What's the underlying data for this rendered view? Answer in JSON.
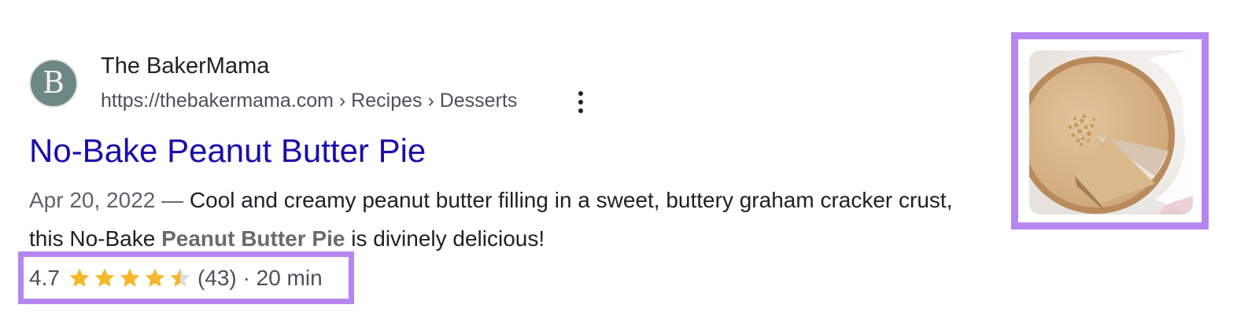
{
  "result": {
    "site_name": "The BakerMama",
    "favicon_letter": "B",
    "url": "https://thebakermama.com › Recipes › Desserts",
    "title": "No-Bake Peanut Butter Pie",
    "snippet": {
      "date": "Apr 20, 2022",
      "separator": " — ",
      "text_before": "Cool and creamy peanut butter filling in a sweet, buttery graham cracker crust, this No-Bake ",
      "bold": "Peanut Butter Pie",
      "text_after": " is divinely delicious!"
    },
    "rating": {
      "value": "4.7",
      "stars_filled": 4.5,
      "stars_total": 5,
      "count": "(43)",
      "separator": " · ",
      "time": "20 min"
    },
    "thumbnail": {
      "subject": "peanut-butter-pie-image"
    }
  },
  "colors": {
    "title_link": "#1a0dab",
    "highlight": "#b586f0",
    "star_fill": "#f5b829",
    "star_empty": "#dadce0",
    "favicon_bg": "#6d8784"
  },
  "icons": {
    "more": "three-dots-vertical-icon",
    "star": "star-icon",
    "half_star": "half-star-icon"
  }
}
